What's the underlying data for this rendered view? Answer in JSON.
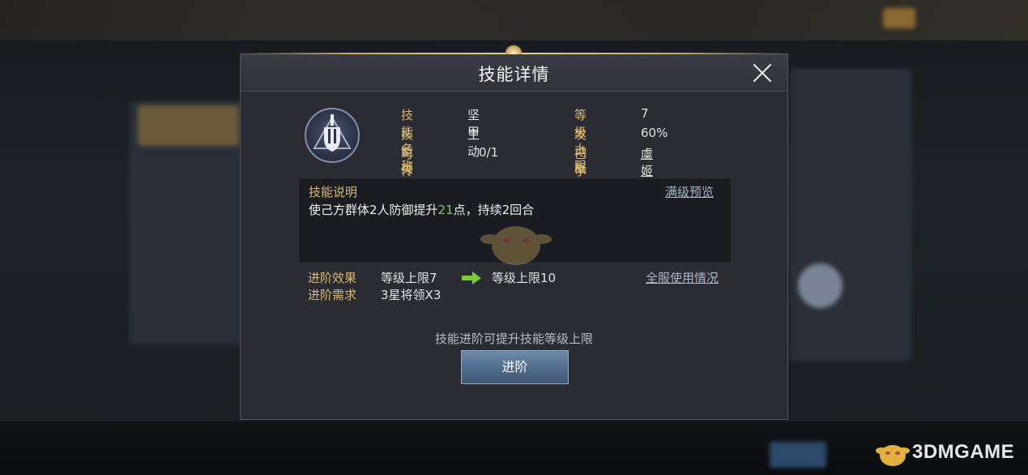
{
  "dialog": {
    "title": "技能详情"
  },
  "skill": {
    "name_label": "技能名称",
    "name": "坚甲",
    "type_label": "技能类型",
    "type": "主动",
    "inherit_label": "可传承数量",
    "inherit": "0/1",
    "max_level_label": "等级上限",
    "max_level": "7",
    "trigger_label": "发动概率",
    "trigger": "60%",
    "learned_label": "已学将领",
    "learned": "虞姬"
  },
  "description": {
    "title": "技能说明",
    "text_before": "使己方群体2人防御提升",
    "highlight": "21",
    "text_after": "点，持续2回合",
    "preview_link": "满级预览"
  },
  "advance": {
    "effect_label": "进阶效果",
    "effect_from": "等级上限7",
    "effect_to": "等级上限10",
    "requirement_label": "进阶需求",
    "requirement": "3星将领X3",
    "server_link": "全服使用情况",
    "hint": "技能进阶可提升技能等级上限",
    "button": "进阶"
  },
  "watermark": {
    "text": "3DMGAME"
  },
  "colors": {
    "gold_label": "#d7b872",
    "highlight_green": "#7ed34a",
    "button_blue": "#5a7696"
  }
}
